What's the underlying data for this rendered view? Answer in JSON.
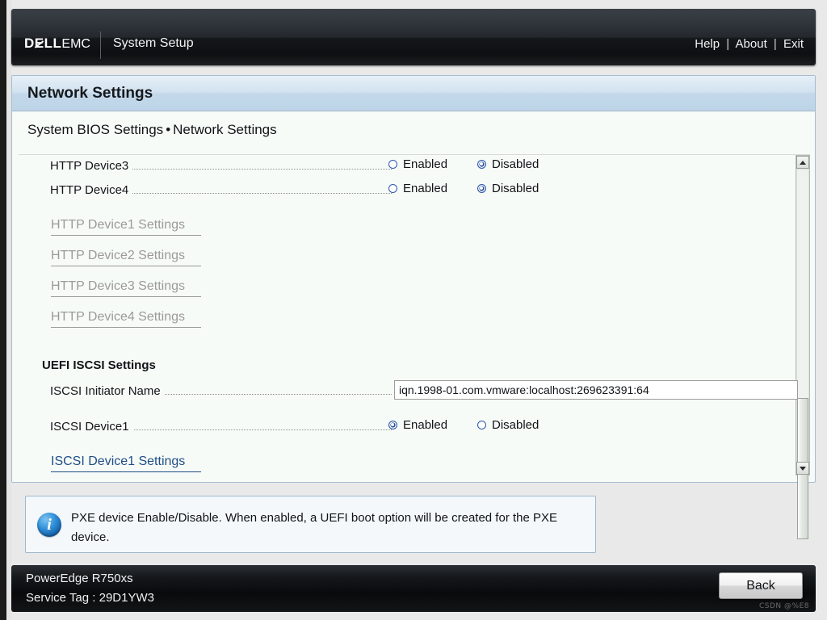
{
  "header": {
    "logo_dell": "DELL",
    "logo_emc": "EMC",
    "app_title": "System Setup",
    "links": [
      {
        "label": "Help"
      },
      {
        "label": "About"
      },
      {
        "label": "Exit"
      }
    ],
    "separator": "|"
  },
  "panel": {
    "title": "Network Settings",
    "breadcrumb_parent": "System BIOS Settings",
    "breadcrumb_dot": "•",
    "breadcrumb_current": "Network Settings"
  },
  "settings": {
    "radio_rows": [
      {
        "label": "HTTP Device3",
        "enabled_label": "Enabled",
        "disabled_label": "Disabled",
        "selected": "Disabled"
      },
      {
        "label": "HTTP Device4",
        "enabled_label": "Enabled",
        "disabled_label": "Disabled",
        "selected": "Disabled"
      }
    ],
    "http_device_links": [
      {
        "label": "HTTP Device1 Settings",
        "state": "disabled"
      },
      {
        "label": "HTTP Device2 Settings",
        "state": "disabled"
      },
      {
        "label": "HTTP Device3 Settings",
        "state": "disabled"
      },
      {
        "label": "HTTP Device4 Settings",
        "state": "disabled"
      }
    ],
    "iscsi_section_title": "UEFI ISCSI Settings",
    "iscsi_initiator": {
      "label": "ISCSI Initiator Name",
      "value": "iqn.1998-01.com.vmware:localhost:269623391:64"
    },
    "iscsi_device1": {
      "label": "ISCSI Device1",
      "enabled_label": "Enabled",
      "disabled_label": "Disabled",
      "selected": "Enabled"
    },
    "iscsi_device1_link": {
      "label": "ISCSI Device1 Settings",
      "state": "enabled"
    }
  },
  "help": {
    "icon": "info-icon",
    "text": "PXE device Enable/Disable. When enabled, a UEFI boot option will be created for the PXE device."
  },
  "footer": {
    "model": "PowerEdge R750xs",
    "service_tag": "Service Tag : 29D1YW3",
    "back_label": "Back",
    "watermark": "CSDN @%E8"
  },
  "colors": {
    "accent_blue": "#2a50a0",
    "link_blue": "#1f4e87",
    "panel_border": "#a9bccf",
    "header_dark": "#15181b"
  },
  "scroll": {
    "up_arrow": "scroll-up-arrow",
    "down_arrow": "scroll-down-arrow"
  }
}
